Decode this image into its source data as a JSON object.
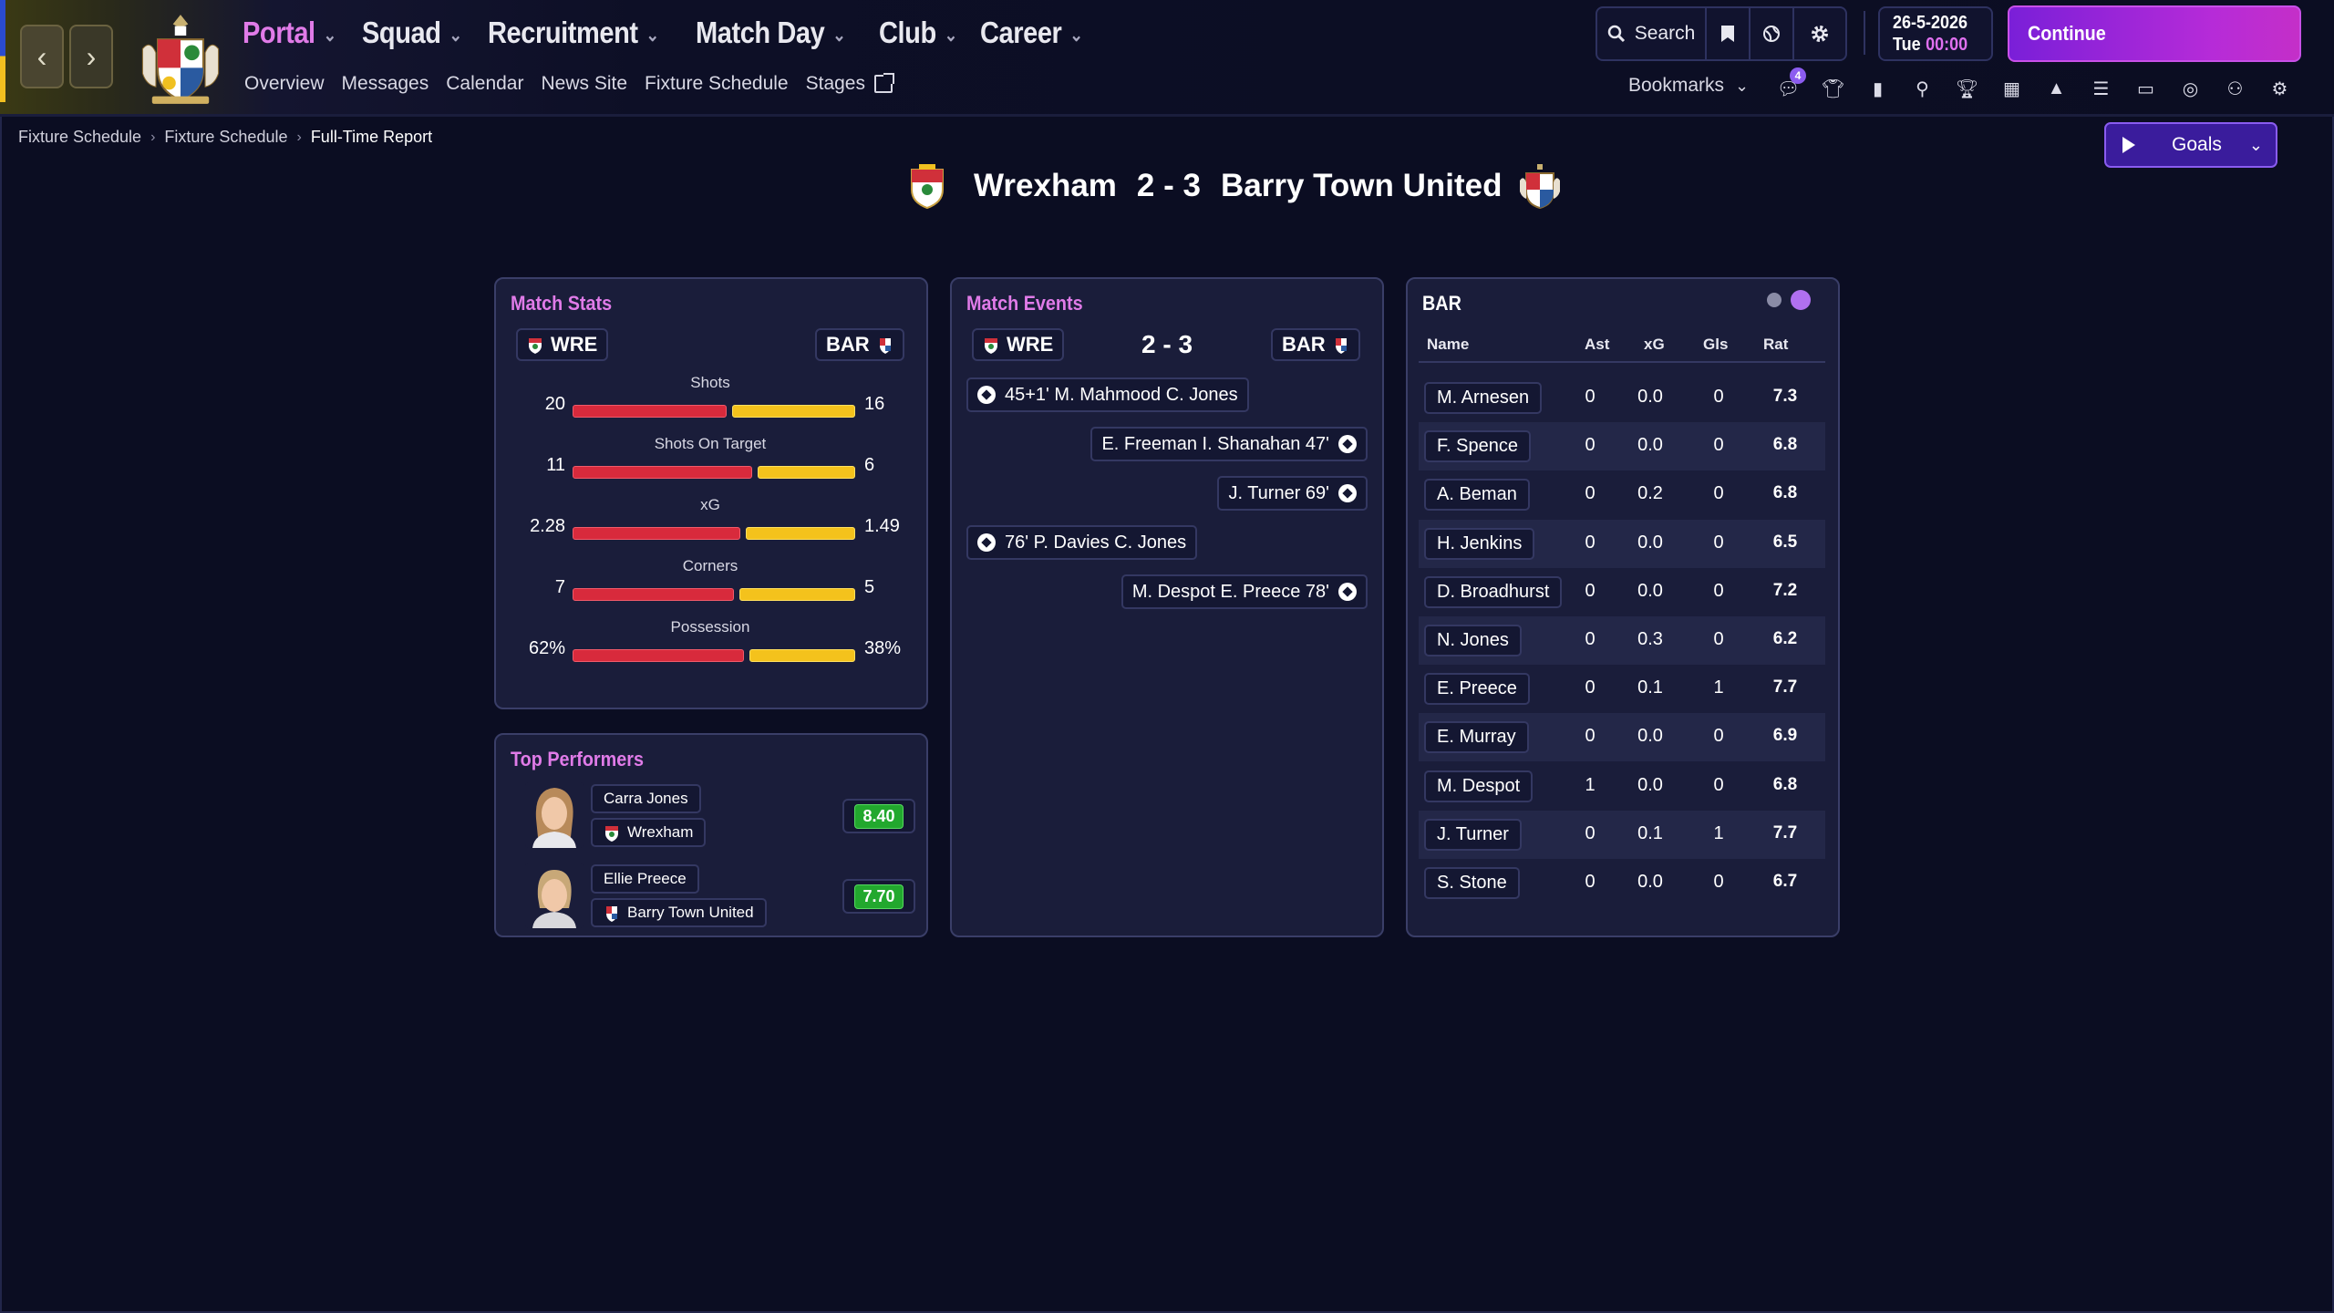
{
  "nav": {
    "main": [
      {
        "label": "Portal",
        "active": true
      },
      {
        "label": "Squad"
      },
      {
        "label": "Recruitment"
      },
      {
        "label": "Match Day"
      },
      {
        "label": "Club"
      },
      {
        "label": "Career"
      }
    ],
    "sub": [
      "Overview",
      "Messages",
      "Calendar",
      "News Site",
      "Fixture Schedule",
      "Stages"
    ],
    "search_label": "Search",
    "date": "26-5-2026",
    "day": "Tue",
    "time": "00:00",
    "continue_label": "Continue",
    "bookmarks_label": "Bookmarks",
    "notification_count": "4"
  },
  "breadcrumb": [
    "Fixture Schedule",
    "Fixture Schedule",
    "Full-Time Report"
  ],
  "goals_label": "Goals",
  "match": {
    "home": "Wrexham",
    "away": "Barry Town United",
    "score": "2 - 3",
    "home_abbr": "WRE",
    "away_abbr": "BAR"
  },
  "match_stats": {
    "title": "Match Stats",
    "stats": [
      {
        "label": "Shots",
        "home": "20",
        "away": "16",
        "home_share": 0.556
      },
      {
        "label": "Shots On Target",
        "home": "11",
        "away": "6",
        "home_share": 0.647
      },
      {
        "label": "xG",
        "home": "2.28",
        "away": "1.49",
        "home_share": 0.605
      },
      {
        "label": "Corners",
        "home": "7",
        "away": "5",
        "home_share": 0.583
      },
      {
        "label": "Possession",
        "home": "62%",
        "away": "38%",
        "home_share": 0.62
      }
    ]
  },
  "top_performers": {
    "title": "Top Performers",
    "players": [
      {
        "name": "Carra Jones",
        "team": "Wrexham",
        "rating": "8.40"
      },
      {
        "name": "Ellie Preece",
        "team": "Barry Town United",
        "rating": "7.70"
      }
    ]
  },
  "match_events": {
    "title": "Match Events",
    "score": "2 - 3",
    "events": [
      {
        "side": "home",
        "text": "45+1' M. Mahmood C. Jones"
      },
      {
        "side": "away",
        "text": "E. Freeman I. Shanahan 47'"
      },
      {
        "side": "away",
        "text": "J. Turner 69'"
      },
      {
        "side": "home",
        "text": "76' P. Davies C. Jones"
      },
      {
        "side": "away",
        "text": "M. Despot E. Preece 78'"
      }
    ]
  },
  "team_table": {
    "title": "BAR",
    "headers": [
      "Name",
      "Ast",
      "xG",
      "Gls",
      "Rat"
    ],
    "rows": [
      [
        "M. Arnesen",
        "0",
        "0.0",
        "0",
        "7.3"
      ],
      [
        "F. Spence",
        "0",
        "0.0",
        "0",
        "6.8"
      ],
      [
        "A. Beman",
        "0",
        "0.2",
        "0",
        "6.8"
      ],
      [
        "H. Jenkins",
        "0",
        "0.0",
        "0",
        "6.5"
      ],
      [
        "D. Broadhurst",
        "0",
        "0.0",
        "0",
        "7.2"
      ],
      [
        "N. Jones",
        "0",
        "0.3",
        "0",
        "6.2"
      ],
      [
        "E. Preece",
        "0",
        "0.1",
        "1",
        "7.7"
      ],
      [
        "E. Murray",
        "0",
        "0.0",
        "0",
        "6.9"
      ],
      [
        "M. Despot",
        "1",
        "0.0",
        "0",
        "6.8"
      ],
      [
        "J. Turner",
        "0",
        "0.1",
        "1",
        "7.7"
      ],
      [
        "S. Stone",
        "0",
        "0.0",
        "0",
        "6.7"
      ]
    ]
  },
  "colors": {
    "accent": "#e07be8",
    "home_bar": "#d82a3c",
    "away_bar": "#f4c21c",
    "rating_green": "#22a82e"
  }
}
